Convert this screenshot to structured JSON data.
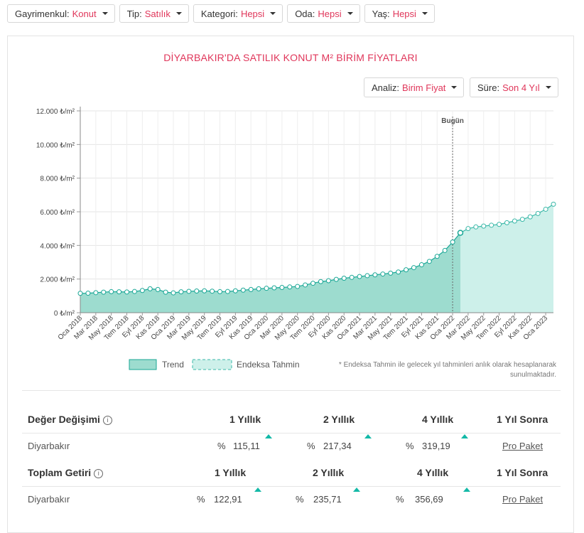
{
  "filters": [
    {
      "label": "Gayrimenkul:",
      "value": "Konut"
    },
    {
      "label": "Tip:",
      "value": "Satılık"
    },
    {
      "label": "Kategori:",
      "value": "Hepsi"
    },
    {
      "label": "Oda:",
      "value": "Hepsi"
    },
    {
      "label": "Yaş:",
      "value": "Hepsi"
    }
  ],
  "controls": {
    "analiz_label": "Analiz:",
    "analiz_value": "Birim Fiyat",
    "sure_label": "Süre:",
    "sure_value": "Son 4 Yıl"
  },
  "chart_data": {
    "type": "area",
    "title": "DİYARBAKIR'DA SATILIK KONUT M² BİRİM FİYATLARI",
    "y_unit": "₺/m²",
    "ylim": [
      0,
      12000
    ],
    "y_ticks": [
      "12.000 ₺/m²",
      "10.000 ₺/m²",
      "8.000 ₺/m²",
      "6.000 ₺/m²",
      "4.000 ₺/m²",
      "2.000 ₺/m²",
      "0 ₺/m²"
    ],
    "y_tick_values": [
      12000,
      10000,
      8000,
      6000,
      4000,
      2000,
      0
    ],
    "x_tick_labels": [
      "Oca 2018",
      "Mar 2018",
      "May 2018",
      "Tem 2018",
      "Eyl 2018",
      "Kas 2018",
      "Oca 2019",
      "Mar 2019",
      "May 2019",
      "Tem 2019",
      "Eyl 2019",
      "Kas 2019",
      "Oca 2020",
      "Mar 2020",
      "May 2020",
      "Tem 2020",
      "Eyl 2020",
      "Kas 2020",
      "Oca 2021",
      "Mar 2021",
      "May 2021",
      "Tem 2021",
      "Eyl 2021",
      "Kas 2021",
      "Oca 2022",
      "Mar 2022",
      "May 2022",
      "Tem 2022",
      "Eyl 2022",
      "Kas 2022",
      "Oca 2023"
    ],
    "today_label": "Bugün",
    "today_index": 48,
    "grid": true,
    "legend_position": "bottom",
    "series": [
      {
        "name": "Trend",
        "color": "#9ddccf",
        "line_color": "#1aa796",
        "values": [
          1150,
          1160,
          1190,
          1220,
          1250,
          1240,
          1230,
          1260,
          1320,
          1420,
          1380,
          1220,
          1180,
          1240,
          1270,
          1290,
          1300,
          1280,
          1250,
          1260,
          1300,
          1340,
          1380,
          1420,
          1450,
          1480,
          1500,
          1530,
          1560,
          1650,
          1750,
          1850,
          1900,
          1980,
          2050,
          2100,
          2150,
          2200,
          2250,
          2300,
          2350,
          2420,
          2550,
          2680,
          2850,
          3050,
          3350,
          3700,
          4200,
          4750
        ]
      },
      {
        "name": "Endeksa Tahmin",
        "color": "#cdf0ea",
        "line_color": "#3ab8a8",
        "values": [
          4750,
          5000,
          5100,
          5150,
          5200,
          5250,
          5350,
          5450,
          5550,
          5700,
          5900,
          6150,
          6450
        ]
      }
    ]
  },
  "note": "* Endeksa Tahmin ile gelecek yıl tahminleri anlık olarak hesaplanarak sunulmaktadır.",
  "deger": {
    "title": "Değer Değişimi",
    "info": "i",
    "cols": [
      "1 Yıllık",
      "2 Yıllık",
      "4 Yıllık",
      "1 Yıl Sonra"
    ],
    "row_label": "Diyarbakır",
    "pct": "%",
    "values": [
      "115,11",
      "217,34",
      "319,19"
    ],
    "pro": "Pro Paket"
  },
  "getiri": {
    "title": "Toplam Getiri",
    "info": "i",
    "cols": [
      "1 Yıllık",
      "2 Yıllık",
      "4 Yıllık",
      "1 Yıl Sonra"
    ],
    "row_label": "Diyarbakır",
    "pct": "%",
    "values": [
      "122,91",
      "235,71",
      "356,69"
    ],
    "pro": "Pro Paket"
  }
}
